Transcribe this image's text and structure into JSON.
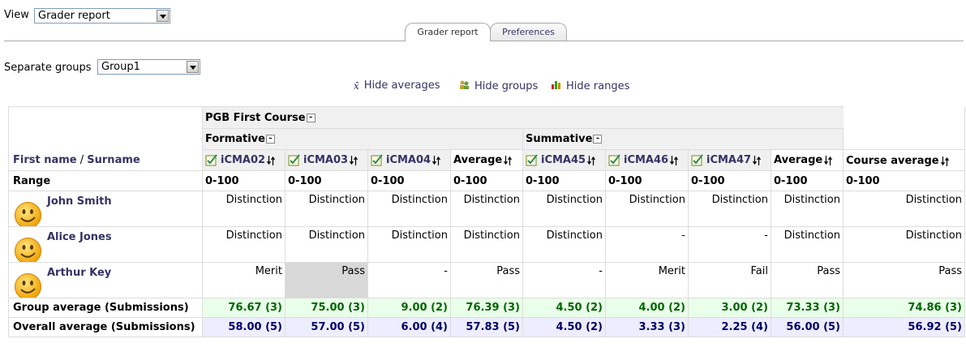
{
  "view": {
    "label": "View",
    "selected": "Grader report"
  },
  "tabs": [
    {
      "label": "Grader report",
      "active": true
    },
    {
      "label": "Preferences",
      "active": false
    }
  ],
  "groups": {
    "label": "Separate groups",
    "selected": "Group1"
  },
  "toolbar": {
    "hide_averages": "Hide averages",
    "hide_groups": "Hide groups",
    "hide_ranges": "Hide ranges"
  },
  "table": {
    "course": "PGB First Course",
    "categories": [
      "Formative",
      "Summative"
    ],
    "name_header": {
      "first": "First name",
      "sep": " / ",
      "last": "Surname"
    },
    "columns": [
      "iCMA02",
      "iCMA03",
      "iCMA04",
      "Average",
      "iCMA45",
      "iCMA46",
      "iCMA47",
      "Average",
      "Course average"
    ],
    "range_label": "Range",
    "ranges": [
      "0-100",
      "0-100",
      "0-100",
      "0-100",
      "0-100",
      "0-100",
      "0-100",
      "0-100",
      "0-100"
    ],
    "students": [
      {
        "name": "John Smith",
        "grades": [
          "Distinction",
          "Distinction",
          "Distinction",
          "Distinction",
          "Distinction",
          "Distinction",
          "Distinction",
          "Distinction",
          "Distinction"
        ]
      },
      {
        "name": "Alice Jones",
        "grades": [
          "Distinction",
          "Distinction",
          "Distinction",
          "Distinction",
          "Distinction",
          "-",
          "-",
          "Distinction",
          "Distinction"
        ]
      },
      {
        "name": "Arthur Key",
        "grades": [
          "Merit",
          "Pass",
          "-",
          "Pass",
          "-",
          "Merit",
          "Fail",
          "Pass",
          "Pass"
        ]
      }
    ],
    "group_average": {
      "label": "Group average (Submissions)",
      "values": [
        "76.67 (3)",
        "75.00 (3)",
        "9.00 (2)",
        "76.39 (3)",
        "4.50 (2)",
        "4.00 (2)",
        "3.00 (2)",
        "73.33 (3)",
        "74.86 (3)"
      ]
    },
    "overall_average": {
      "label": "Overall average (Submissions)",
      "values": [
        "58.00 (5)",
        "57.00 (5)",
        "6.00 (4)",
        "57.83 (5)",
        "4.50 (2)",
        "3.33 (3)",
        "2.25 (4)",
        "56.00 (5)",
        "56.92 (5)"
      ]
    }
  },
  "colors": {
    "link": "#333366",
    "group_bg": "#eaffea",
    "overall_bg": "#ededff",
    "group_text": "#006600",
    "overall_text": "#000066"
  }
}
